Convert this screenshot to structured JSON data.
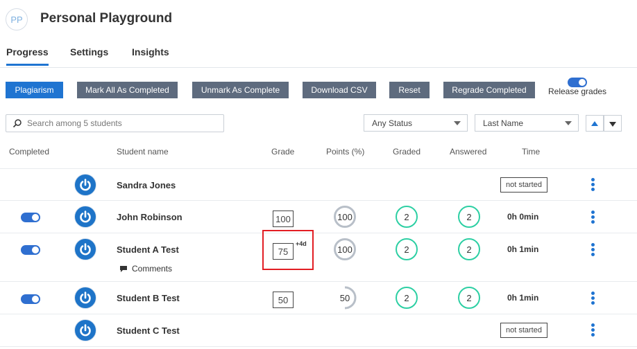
{
  "header": {
    "avatar_initials": "PP",
    "title": "Personal Playground"
  },
  "tabs": [
    {
      "label": "Progress",
      "active": true
    },
    {
      "label": "Settings",
      "active": false
    },
    {
      "label": "Insights",
      "active": false
    }
  ],
  "toolbar": {
    "plagiarism": "Plagiarism",
    "mark_all": "Mark All As Completed",
    "unmark": "Unmark As Complete",
    "download_csv": "Download CSV",
    "reset": "Reset",
    "regrade": "Regrade Completed",
    "release_grades": "Release grades",
    "release_grades_on": true
  },
  "filters": {
    "search_placeholder": "Search among 5 students",
    "search_value": "",
    "status": "Any Status",
    "sort_by": "Last Name"
  },
  "columns": {
    "completed": "Completed",
    "student_name": "Student name",
    "grade": "Grade",
    "points": "Points (%)",
    "graded": "Graded",
    "answered": "Answered",
    "time": "Time"
  },
  "rows": [
    {
      "name": "Sandra Jones",
      "completed": false,
      "grade": "",
      "points": "",
      "graded": "",
      "answered": "",
      "time": "",
      "status": "not started"
    },
    {
      "name": "John Robinson",
      "completed": true,
      "grade": "100",
      "points": "100",
      "graded": "2",
      "answered": "2",
      "time": "0h 0min",
      "status": ""
    },
    {
      "name": "Student A Test",
      "completed": true,
      "grade": "75",
      "late": "+4d",
      "points": "100",
      "graded": "2",
      "answered": "2",
      "time": "0h 1min",
      "status": "",
      "comments_label": "Comments"
    },
    {
      "name": "Student B Test",
      "completed": true,
      "grade": "50",
      "points": "50",
      "graded": "2",
      "answered": "2",
      "time": "0h 1min",
      "status": ""
    },
    {
      "name": "Student C Test",
      "completed": false,
      "grade": "",
      "points": "",
      "graded": "",
      "answered": "",
      "time": "",
      "status": "not started"
    }
  ],
  "colors": {
    "accent": "#1f74d1",
    "button_gray": "#5e6b7e",
    "ring_green": "#2ccfa3",
    "ring_gray": "#b8bfc8",
    "highlight_red": "#e21d23"
  }
}
